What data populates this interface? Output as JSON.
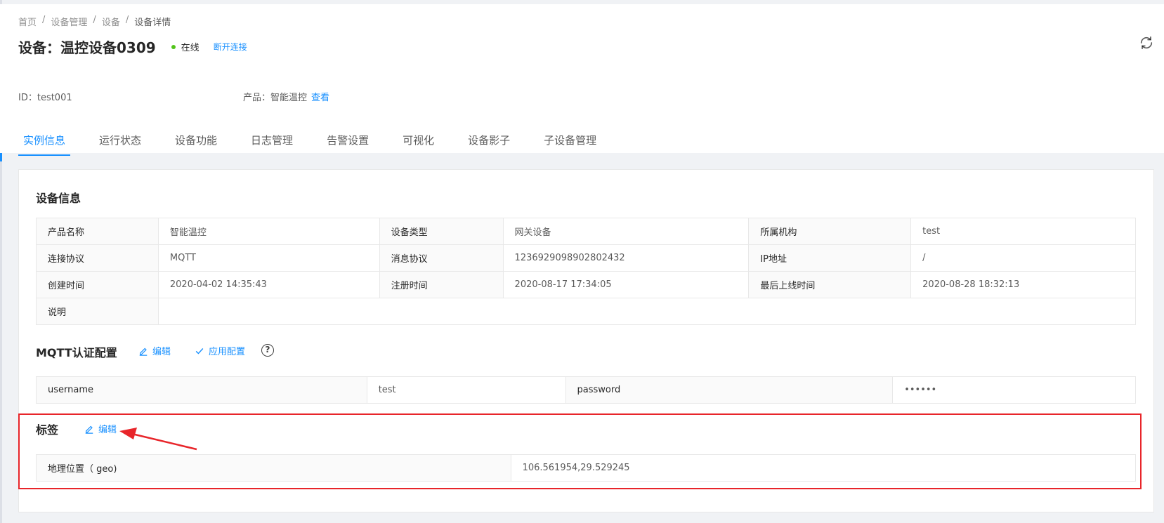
{
  "breadcrumb": [
    "首页",
    "设备管理",
    "设备",
    "设备详情"
  ],
  "header": {
    "title": "设备：温控设备0309",
    "status": "在线",
    "disconnect_label": "断开连接",
    "id_text": "ID：test001",
    "product_text": "产品：智能温控",
    "product_view_label": "查看",
    "refresh_icon": "refresh-icon"
  },
  "tabs": [
    "实例信息",
    "运行状态",
    "设备功能",
    "日志管理",
    "告警设置",
    "可视化",
    "设备影子",
    "子设备管理"
  ],
  "active_tab": 0,
  "device_info": {
    "title": "设备信息",
    "rows": [
      [
        {
          "label": "产品名称",
          "value": "智能温控"
        },
        {
          "label": "设备类型",
          "value": "网关设备"
        },
        {
          "label": "所属机构",
          "value": "test"
        }
      ],
      [
        {
          "label": "连接协议",
          "value": "MQTT"
        },
        {
          "label": "消息协议",
          "value": "1236929098902802432"
        },
        {
          "label": "IP地址",
          "value": "/"
        }
      ],
      [
        {
          "label": "创建时间",
          "value": "2020-04-02 14:35:43"
        },
        {
          "label": "注册时间",
          "value": "2020-08-17 17:34:05"
        },
        {
          "label": "最后上线时间",
          "value": "2020-08-28 18:32:13"
        }
      ]
    ],
    "description_label": "说明",
    "description_value": ""
  },
  "mqtt": {
    "title": "MQTT认证配置",
    "edit_label": "编辑",
    "apply_label": "应用配置",
    "help_icon": "?",
    "username_label": "username",
    "username_value": "test",
    "password_label": "password",
    "password_value": "••••••"
  },
  "tags": {
    "title": "标签",
    "edit_label": "编辑",
    "geo_label": "地理位置（ geo)",
    "geo_value": "106.561954,29.529245"
  },
  "colors": {
    "primary": "#1890ff",
    "online": "#52c41a",
    "highlight": "#e8252a"
  }
}
